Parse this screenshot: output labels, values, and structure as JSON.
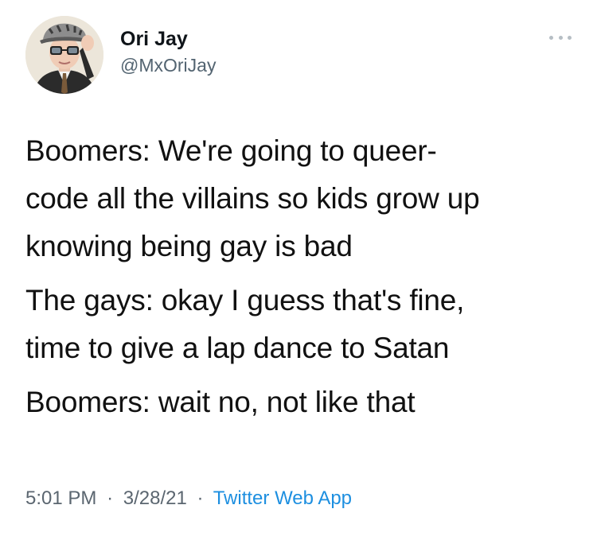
{
  "author": {
    "display_name": "Ori Jay",
    "handle": "@MxOriJay"
  },
  "tweet": {
    "paragraphs": [
      "Boomers: We're going to queer-\ncode all the villains so kids grow up\nknowing being gay is bad",
      "The gays: okay I guess that's fine,\ntime to give a lap dance to Satan",
      "Boomers: wait no, not like that"
    ],
    "time": "5:01 PM",
    "date": "3/28/21",
    "source": "Twitter Web App",
    "separator": "·"
  },
  "icons": {
    "more": "more-options-icon",
    "avatar": "profile-avatar"
  },
  "colors": {
    "name": "#0f1419",
    "handle": "#536471",
    "link": "#1d8fe0",
    "meta": "#5b6670"
  }
}
